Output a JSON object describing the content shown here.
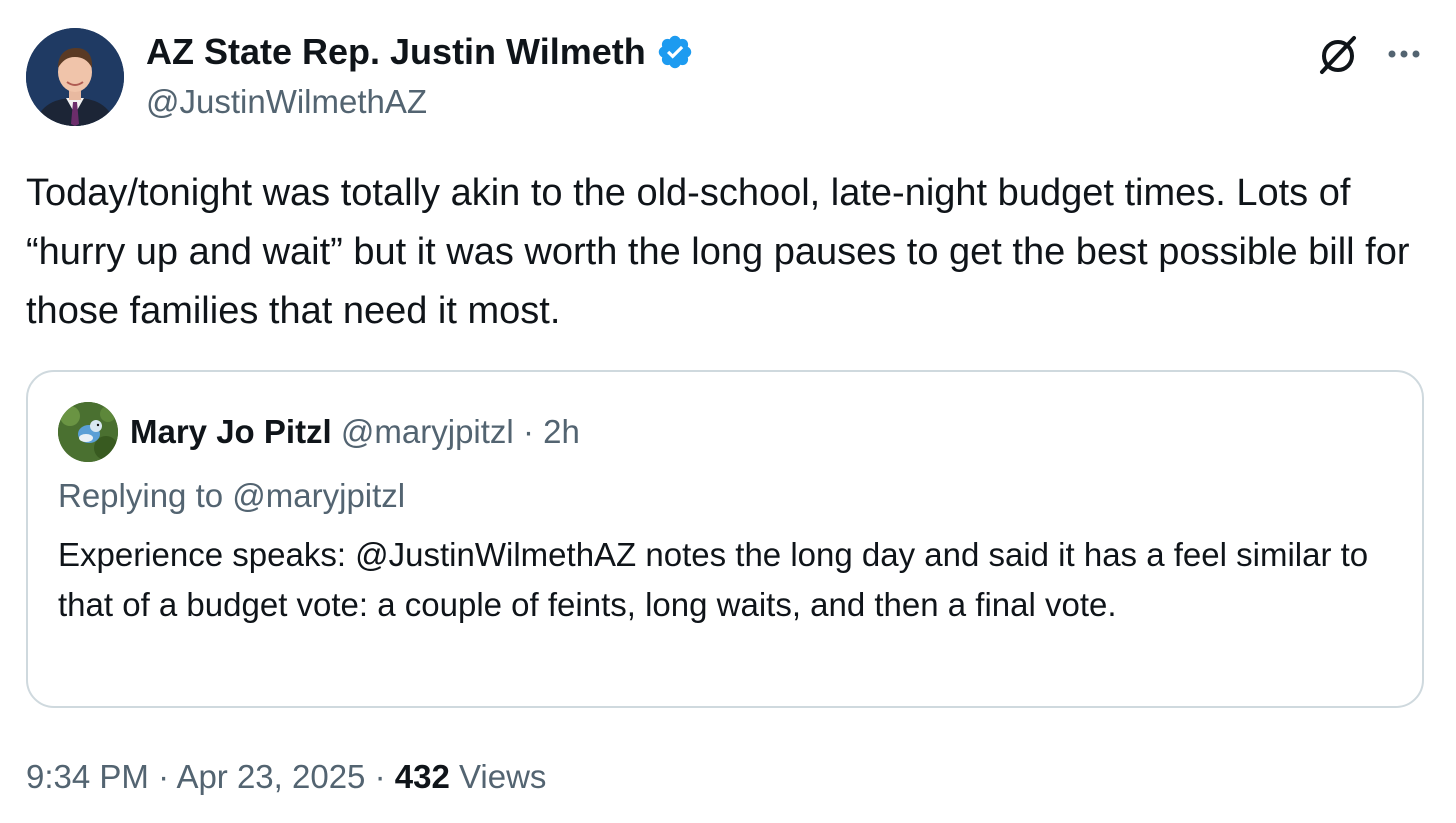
{
  "author": {
    "name": "AZ State Rep. Justin Wilmeth",
    "handle": "@JustinWilmethAZ",
    "verified_color": "#1d9bf0"
  },
  "icons": {
    "grok": "grok-icon",
    "more": "more-options-icon",
    "verified": "verified-badge-icon"
  },
  "tweet": {
    "text": "Today/tonight was totally akin to the old-school, late-night budget times. Lots of “hurry up and wait” but it was worth the long pauses to get the best possible bill for those families that need it most."
  },
  "quote": {
    "name": "Mary Jo Pitzl",
    "handle": "@maryjpitzl",
    "separator": "·",
    "time": "2h",
    "replying_label": "Replying to",
    "replying_handle": "@maryjpitzl",
    "text": "Experience speaks: @JustinWilmethAZ notes the long day and said it has a feel similar to that of a budget vote: a couple of feints, long waits, and then a final vote."
  },
  "footer": {
    "time": "9:34 PM",
    "separator": "·",
    "date": "Apr 23, 2025",
    "views_count": "432",
    "views_label": "Views"
  },
  "colors": {
    "text_primary": "#0f1419",
    "text_secondary": "#536471",
    "border": "#cfd9de"
  }
}
